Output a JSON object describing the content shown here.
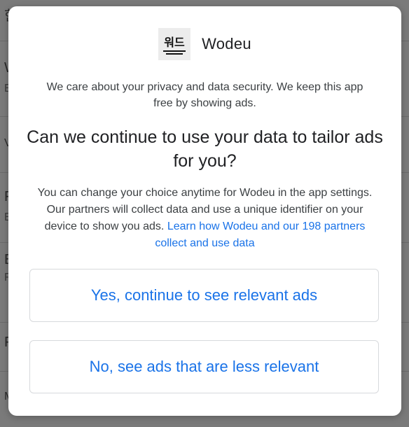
{
  "background": {
    "rows": [
      {
        "title": "한",
        "subtitle": ""
      },
      {
        "title": "W",
        "subtitle": "E"
      },
      {
        "title": "V",
        "subtitle": ""
      },
      {
        "title": "F",
        "subtitle": "E"
      },
      {
        "title": "E",
        "subtitle": "F"
      },
      {
        "title": "F",
        "subtitle": ""
      },
      {
        "title": "M",
        "subtitle": ""
      }
    ]
  },
  "dialog": {
    "brand": {
      "logo_text": "워드",
      "name": "Wodeu"
    },
    "intro": "We care about your privacy and data security. We keep this app free by showing ads.",
    "question": "Can we continue to use your data to tailor ads for you?",
    "details_text": "You can change your choice anytime for Wodeu in the app settings. Our partners will collect data and use a unique identifier on your device to show you ads.",
    "details_link": "Learn how Wodeu and our 198 partners collect and use data",
    "buttons": {
      "yes": "Yes, continue to see relevant ads",
      "no": "No, see ads that are less relevant"
    }
  },
  "colors": {
    "accent": "#1a73e8",
    "scrim": "#7a7a7a"
  }
}
